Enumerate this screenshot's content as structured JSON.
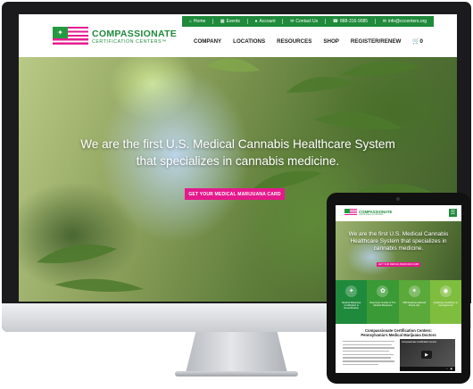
{
  "desktop": {
    "util_bar": {
      "home": "Home",
      "events": "Events",
      "account": "Account",
      "contact": "Contact Us",
      "phone": "888-316-9085",
      "email": "info@cccenters.org"
    },
    "logo": {
      "line1": "COMPASSIONATE",
      "line2": "CERTIFICATION CENTERS™"
    },
    "nav": [
      "COMPANY",
      "LOCATIONS",
      "RESOURCES",
      "SHOP",
      "REGISTER/RENEW"
    ],
    "cart_count": "0",
    "hero": {
      "title_line1": "We are the first U.S. Medical Cannabis Healthcare System",
      "title_line2": "that specializes in cannabis medicine.",
      "button": "GET YOUR MEDICAL MARIJUANA CARD"
    }
  },
  "tablet": {
    "logo": {
      "line1": "COMPASSIONATE",
      "line2": "CERTIFICATION CENTERS"
    },
    "hero": {
      "title": "We are the first U.S. Medical Cannabis Healthcare System that specializes in cannabis medicine.",
      "button": "GET YOUR MEDICAL MARIJUANA CARD"
    },
    "tiles": [
      {
        "label": "Medical Marijuana Certification & Recertification",
        "color": "#1f8a3b"
      },
      {
        "label": "Real Help Outside of The Medical Marijuana",
        "color": "#3a9a35"
      },
      {
        "label": "CBD Endocannabinoid Check-Ups",
        "color": "#5aa93a"
      },
      {
        "label": "Qualifying Conditions to Get Approved",
        "color": "#7fbd3e"
      }
    ],
    "section_title_line1": "Compassionate Certification Centers:",
    "section_title_line2": "Pennsylvania's Medical Marijuana Doctors",
    "video_caption": "Compassionate Certification Centers"
  },
  "colors": {
    "brand_green": "#1f8a3b",
    "brand_pink": "#e5198c"
  }
}
